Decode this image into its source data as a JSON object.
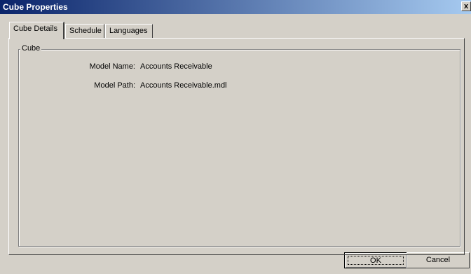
{
  "window": {
    "title": "Cube Properties",
    "close_glyph": "x"
  },
  "tabs": [
    {
      "label": "Cube Details",
      "active": true
    },
    {
      "label": "Schedule",
      "active": false
    },
    {
      "label": "Languages",
      "active": false
    }
  ],
  "group": {
    "label": "Cube"
  },
  "fields": {
    "model_name": {
      "label": "Model Name:",
      "value": "Accounts Receivable"
    },
    "model_path": {
      "label": "Model Path:",
      "value": "Accounts Receivable.mdl"
    }
  },
  "buttons": {
    "ok": "OK",
    "cancel": "Cancel"
  },
  "colors": {
    "titlebar_start": "#0a246a",
    "titlebar_end": "#a6caf0",
    "face": "#d4d0c8"
  }
}
